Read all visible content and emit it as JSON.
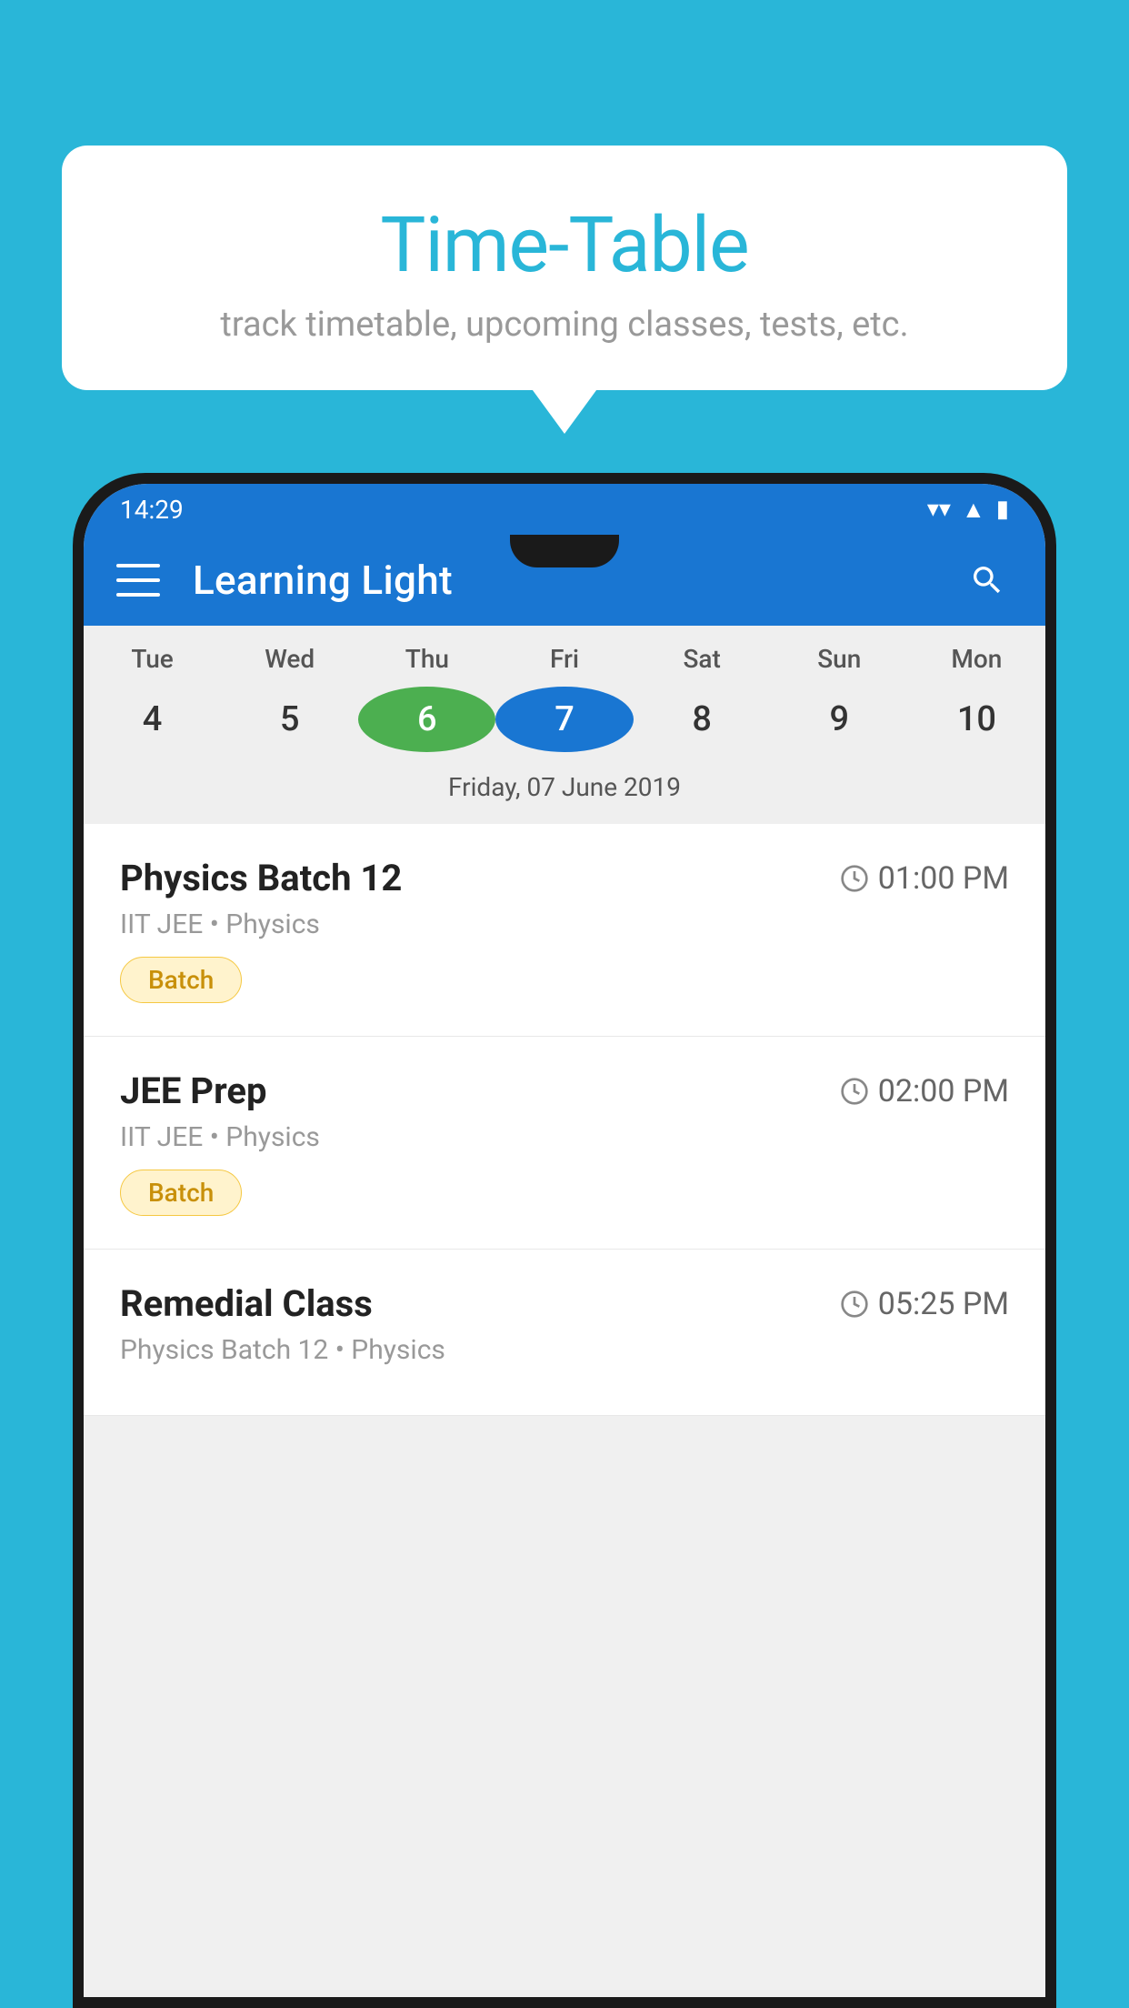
{
  "background_color": "#29B6D8",
  "speech_bubble": {
    "title": "Time-Table",
    "subtitle": "track timetable, upcoming classes, tests, etc."
  },
  "phone": {
    "status_bar": {
      "time": "14:29"
    },
    "app_bar": {
      "title": "Learning Light"
    },
    "calendar": {
      "weekdays": [
        "Tue",
        "Wed",
        "Thu",
        "Fri",
        "Sat",
        "Sun",
        "Mon"
      ],
      "dates": [
        {
          "day": 4,
          "state": "normal"
        },
        {
          "day": 5,
          "state": "normal"
        },
        {
          "day": 6,
          "state": "today"
        },
        {
          "day": 7,
          "state": "selected"
        },
        {
          "day": 8,
          "state": "normal"
        },
        {
          "day": 9,
          "state": "normal"
        },
        {
          "day": 10,
          "state": "normal"
        }
      ],
      "selected_date_label": "Friday, 07 June 2019"
    },
    "schedule": [
      {
        "title": "Physics Batch 12",
        "time": "01:00 PM",
        "subtitle": "IIT JEE • Physics",
        "badge": "Batch"
      },
      {
        "title": "JEE Prep",
        "time": "02:00 PM",
        "subtitle": "IIT JEE • Physics",
        "badge": "Batch"
      },
      {
        "title": "Remedial Class",
        "time": "05:25 PM",
        "subtitle": "Physics Batch 12 • Physics",
        "badge": null
      }
    ]
  }
}
